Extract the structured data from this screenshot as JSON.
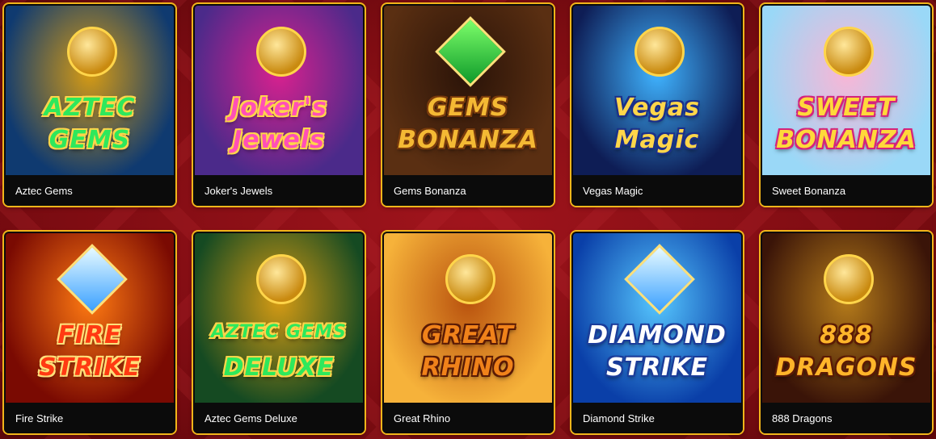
{
  "games": [
    {
      "name": "Aztec Gems",
      "logo_lines": [
        "AZTEC",
        "GEMS"
      ],
      "colors": {
        "bg1": "#0f3a70",
        "bg2": "#d69b14",
        "text": "#2ee85c",
        "stroke": "#ffd54a"
      },
      "icon": "aztec-mask-icon"
    },
    {
      "name": "Joker's Jewels",
      "logo_lines": [
        "Joker's",
        "Jewels"
      ],
      "colors": {
        "bg1": "#4b2a8a",
        "bg2": "#d8218e",
        "text": "#ff4fb7",
        "stroke": "#ffd54a"
      },
      "icon": "jester-mask-icon"
    },
    {
      "name": "Gems Bonanza",
      "logo_lines": [
        "GEMS",
        "BONANZA"
      ],
      "colors": {
        "bg1": "#5a2f12",
        "bg2": "#2a1308",
        "text": "#f4b934",
        "stroke": "#7a3b0c"
      },
      "icon": "emerald-icon"
    },
    {
      "name": "Vegas Magic",
      "logo_lines": [
        "Vegas",
        "Magic"
      ],
      "colors": {
        "bg1": "#0e1d55",
        "bg2": "#3fb3ff",
        "text": "#ffd64a",
        "stroke": "#1b2f8a"
      },
      "icon": "magician-icon"
    },
    {
      "name": "Sweet Bonanza",
      "logo_lines": [
        "SWEET",
        "BONANZA"
      ],
      "colors": {
        "bg1": "#9ad8f7",
        "bg2": "#f9b6d6",
        "text": "#ffd93a",
        "stroke": "#d4237d"
      },
      "icon": "candy-icon"
    },
    {
      "name": "Fire Strike",
      "logo_lines": [
        "FIRE",
        "STRIKE"
      ],
      "colors": {
        "bg1": "#7a0a02",
        "bg2": "#ff7a12",
        "text": "#ff3a12",
        "stroke": "#ffe07a"
      },
      "icon": "diamond-icon"
    },
    {
      "name": "Aztec Gems Deluxe",
      "logo_lines": [
        "AZTEC GEMS",
        "DELUXE"
      ],
      "colors": {
        "bg1": "#154a22",
        "bg2": "#d69b14",
        "text": "#2ee85c",
        "stroke": "#ffd54a"
      },
      "icon": "aztec-mask-icon"
    },
    {
      "name": "Great Rhino",
      "logo_lines": [
        "GREAT",
        "RHINO"
      ],
      "colors": {
        "bg1": "#f6b23a",
        "bg2": "#b9520e",
        "text": "#f0821a",
        "stroke": "#5a1a05"
      },
      "icon": "rhino-icon"
    },
    {
      "name": "Diamond Strike",
      "logo_lines": [
        "DIAMOND",
        "STRIKE"
      ],
      "colors": {
        "bg1": "#0a3fa8",
        "bg2": "#56c7ff",
        "text": "#ffffff",
        "stroke": "#1a3c9a"
      },
      "icon": "diamond-icon"
    },
    {
      "name": "888 Dragons",
      "logo_lines": [
        "888",
        "DRAGONS"
      ],
      "colors": {
        "bg1": "#3a1408",
        "bg2": "#b57b1a",
        "text": "#ffb52a",
        "stroke": "#5a1a05"
      },
      "icon": "dragon-icon"
    }
  ]
}
